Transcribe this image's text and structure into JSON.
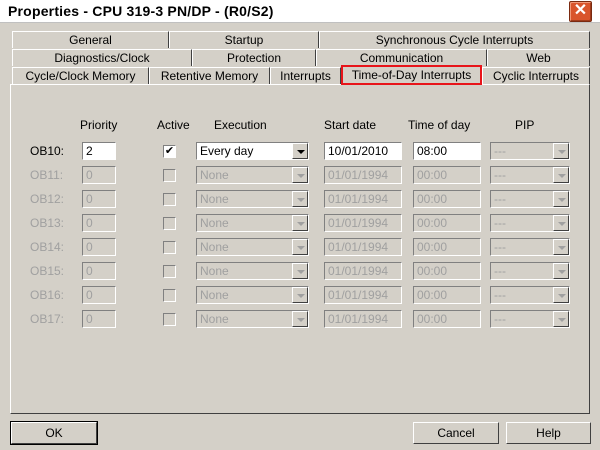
{
  "window": {
    "title": "Properties - CPU 319-3 PN/DP - (R0/S2)",
    "close_glyph": "✕"
  },
  "tabs": {
    "row1": [
      "General",
      "Startup",
      "Synchronous Cycle Interrupts"
    ],
    "row2": [
      "Diagnostics/Clock",
      "Protection",
      "Communication",
      "Web"
    ],
    "row3": [
      "Cycle/Clock Memory",
      "Retentive Memory",
      "Interrupts",
      "Time-of-Day Interrupts",
      "Cyclic Interrupts"
    ],
    "selected": "Time-of-Day Interrupts"
  },
  "columns": {
    "priority": "Priority",
    "active": "Active",
    "execution": "Execution",
    "start_date": "Start date",
    "time_of_day": "Time of day",
    "pip": "PIP"
  },
  "rows": [
    {
      "ob": "OB10:",
      "priority": "2",
      "active": true,
      "execution": "Every day",
      "start_date": "10/01/2010",
      "time": "08:00",
      "pip": "---",
      "enabled": true
    },
    {
      "ob": "OB11:",
      "priority": "0",
      "active": false,
      "execution": "None",
      "start_date": "01/01/1994",
      "time": "00:00",
      "pip": "---",
      "enabled": false
    },
    {
      "ob": "OB12:",
      "priority": "0",
      "active": false,
      "execution": "None",
      "start_date": "01/01/1994",
      "time": "00:00",
      "pip": "---",
      "enabled": false
    },
    {
      "ob": "OB13:",
      "priority": "0",
      "active": false,
      "execution": "None",
      "start_date": "01/01/1994",
      "time": "00:00",
      "pip": "---",
      "enabled": false
    },
    {
      "ob": "OB14:",
      "priority": "0",
      "active": false,
      "execution": "None",
      "start_date": "01/01/1994",
      "time": "00:00",
      "pip": "---",
      "enabled": false
    },
    {
      "ob": "OB15:",
      "priority": "0",
      "active": false,
      "execution": "None",
      "start_date": "01/01/1994",
      "time": "00:00",
      "pip": "---",
      "enabled": false
    },
    {
      "ob": "OB16:",
      "priority": "0",
      "active": false,
      "execution": "None",
      "start_date": "01/01/1994",
      "time": "00:00",
      "pip": "---",
      "enabled": false
    },
    {
      "ob": "OB17:",
      "priority": "0",
      "active": false,
      "execution": "None",
      "start_date": "01/01/1994",
      "time": "00:00",
      "pip": "---",
      "enabled": false
    }
  ],
  "buttons": {
    "ok": "OK",
    "cancel": "Cancel",
    "help": "Help"
  },
  "colors": {
    "highlight": "#e8141a",
    "dialog_bg": "#d4d0c8",
    "close_bg": "#d9552c"
  }
}
